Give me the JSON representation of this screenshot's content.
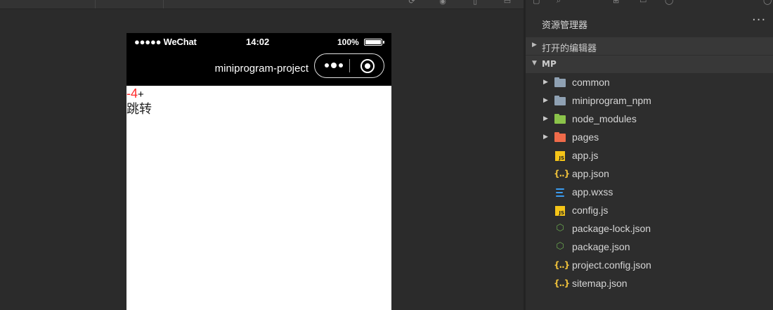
{
  "simulator": {
    "status_bar": {
      "carrier": "●●●●● WeChat",
      "time": "14:02",
      "battery": "100%"
    },
    "nav_bar": {
      "title": "miniprogram-project"
    },
    "page": {
      "minus_label": "-",
      "count": "4",
      "plus_label": "+",
      "jump_label": "跳转"
    }
  },
  "explorer": {
    "title": "资源管理器",
    "more_label": "···",
    "sections": {
      "open_editors": "打开的编辑器",
      "project": "MP"
    },
    "items": [
      {
        "name": "common",
        "kind": "folder",
        "icon": "folder-icon",
        "color": "#8fa1b3"
      },
      {
        "name": "miniprogram_npm",
        "kind": "folder",
        "icon": "folder-icon",
        "color": "#8fa1b3"
      },
      {
        "name": "node_modules",
        "kind": "folder",
        "icon": "node-folder-icon",
        "color": "#8bc34a"
      },
      {
        "name": "pages",
        "kind": "folder",
        "icon": "pages-folder-icon",
        "color": "#ef6b4a"
      },
      {
        "name": "app.js",
        "kind": "file",
        "icon": "js-file-icon"
      },
      {
        "name": "app.json",
        "kind": "file",
        "icon": "json-file-icon"
      },
      {
        "name": "app.wxss",
        "kind": "file",
        "icon": "css-file-icon"
      },
      {
        "name": "config.js",
        "kind": "file",
        "icon": "js-file-icon"
      },
      {
        "name": "package-lock.json",
        "kind": "file",
        "icon": "npm-file-icon"
      },
      {
        "name": "package.json",
        "kind": "file",
        "icon": "npm-file-icon"
      },
      {
        "name": "project.config.json",
        "kind": "file",
        "icon": "json-file-icon"
      },
      {
        "name": "sitemap.json",
        "kind": "file",
        "icon": "json-file-icon"
      }
    ]
  },
  "colors": {
    "accent_red": "#ff2a2a",
    "panel_bg": "#2d2d2d",
    "section_bg": "#383838",
    "js_yellow": "#f5c518",
    "css_blue": "#3b9cf0"
  }
}
